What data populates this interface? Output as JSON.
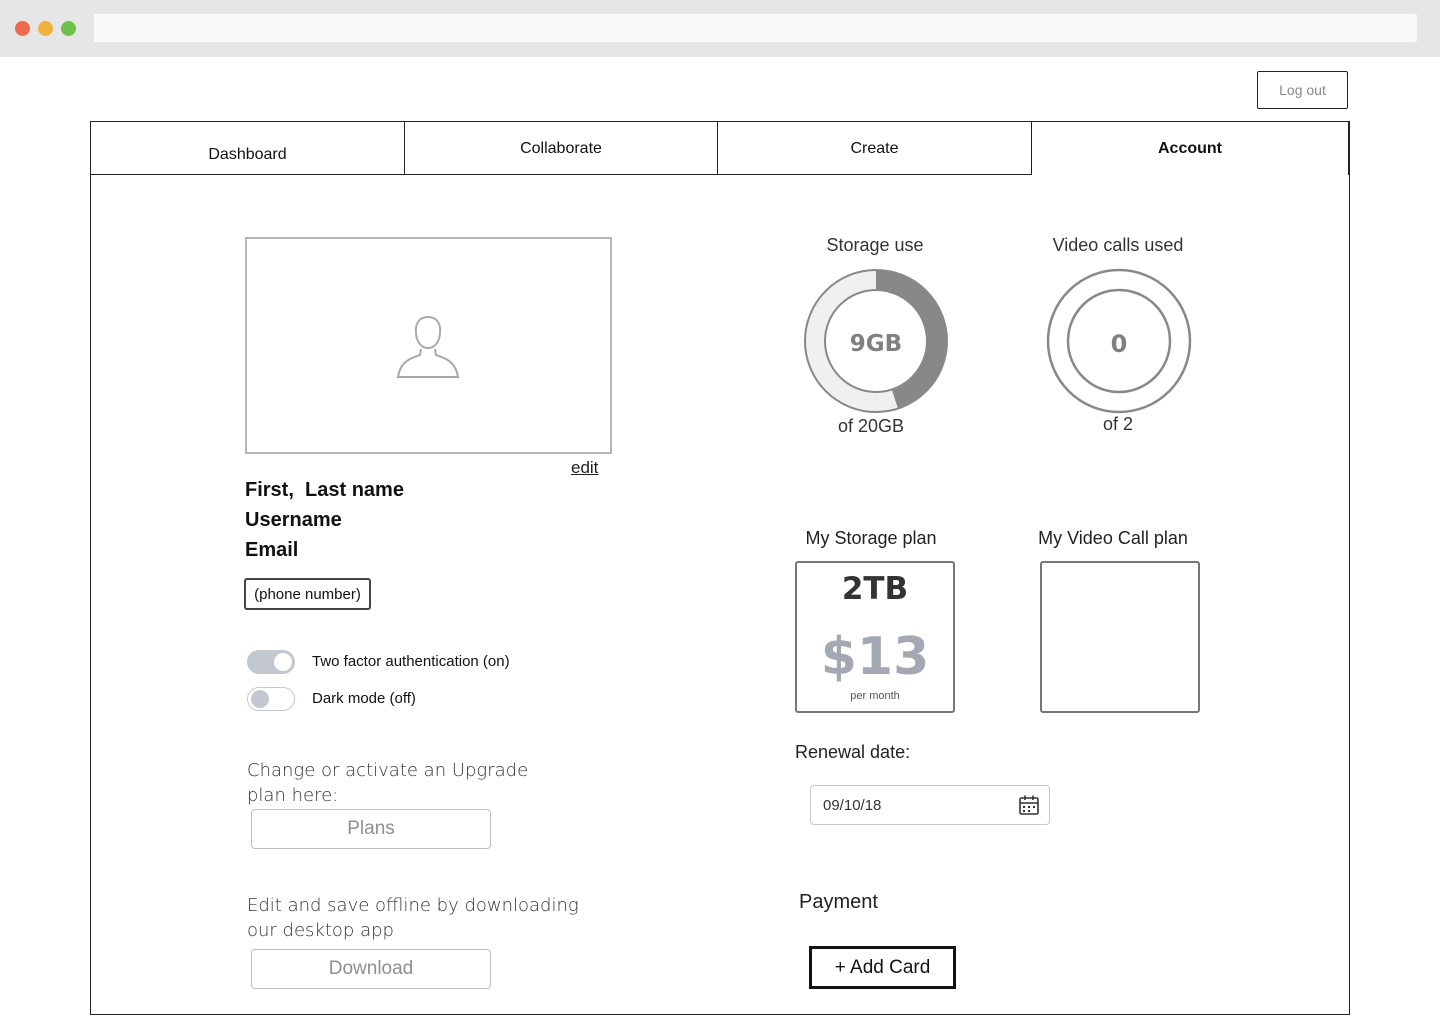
{
  "browser": {
    "dots": [
      "#ec6a4f",
      "#f0b23e",
      "#6cc24a"
    ]
  },
  "header": {
    "logout_label": "Log out"
  },
  "tabs": [
    {
      "label": "Dashboard"
    },
    {
      "label": "Collaborate"
    },
    {
      "label": "Create"
    },
    {
      "label": "Account",
      "active": true
    }
  ],
  "profile": {
    "edit_label": "edit",
    "name": "First,  Last name",
    "username": "Username",
    "email": "Email",
    "phone_label": "(phone number)"
  },
  "settings": {
    "two_factor": {
      "label": "Two factor authentication (on)",
      "on": true
    },
    "dark_mode": {
      "label": "Dark mode (off)",
      "on": false
    }
  },
  "upgrade": {
    "text": "Change or activate an Upgrade plan here:",
    "button_label": "Plans"
  },
  "download": {
    "text": "Edit and save offline by downloading our desktop app",
    "button_label": "Download"
  },
  "storage": {
    "title": "Storage use",
    "value": "9GB",
    "subtitle": "of 20GB",
    "used_fraction": 0.45
  },
  "video_calls": {
    "title": "Video calls used",
    "value": "0",
    "subtitle": "of 2"
  },
  "storage_plan": {
    "title": "My Storage plan",
    "size": "2TB",
    "price": "$13",
    "period": "per month"
  },
  "video_plan": {
    "title": "My Video Call plan"
  },
  "renewal": {
    "label": "Renewal date:",
    "date": "09/10/18"
  },
  "payment": {
    "label": "Payment",
    "add_card_label": "+ Add Card"
  },
  "colors": {
    "gauge_used": "#888888",
    "gauge_track": "#f0f0f0",
    "price": "#a3a8b2",
    "toggle_on": "#c3c7cf"
  }
}
